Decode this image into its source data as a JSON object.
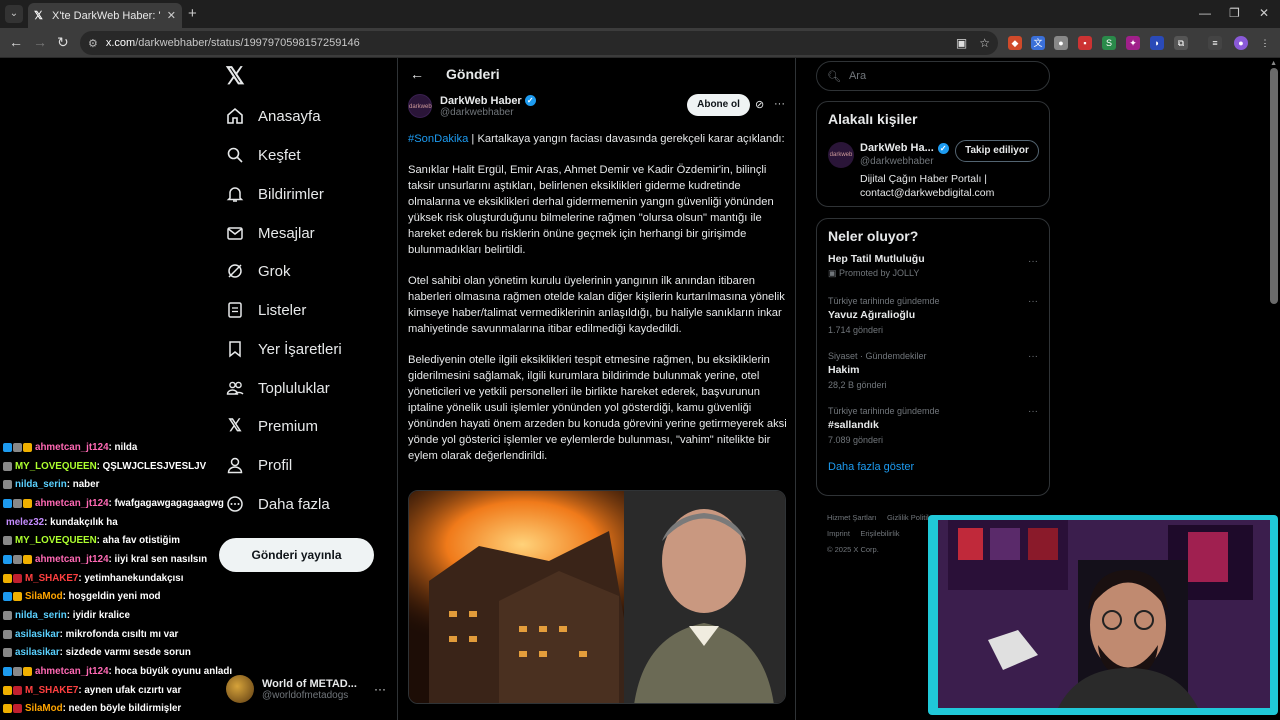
{
  "browser": {
    "tab_title": "X'te DarkWeb Haber: \"#SonDa",
    "url_host": "x.com",
    "url_path": "/darkwebhaber/status/1997970598157259146"
  },
  "nav": {
    "items": [
      {
        "label": "Anasayfa",
        "icon": "home-icon"
      },
      {
        "label": "Keşfet",
        "icon": "search-icon"
      },
      {
        "label": "Bildirimler",
        "icon": "bell-icon"
      },
      {
        "label": "Mesajlar",
        "icon": "mail-icon"
      },
      {
        "label": "Grok",
        "icon": "grok-icon"
      },
      {
        "label": "Listeler",
        "icon": "list-icon"
      },
      {
        "label": "Yer İşaretleri",
        "icon": "bookmark-icon"
      },
      {
        "label": "Topluluklar",
        "icon": "communities-icon"
      },
      {
        "label": "Premium",
        "icon": "x-logo-icon"
      },
      {
        "label": "Profil",
        "icon": "person-icon"
      },
      {
        "label": "Daha fazla",
        "icon": "more-circle-icon"
      }
    ],
    "post_button": "Gönderi yayınla",
    "account_name": "World of METAD...",
    "account_handle": "@worldofmetadogs"
  },
  "main": {
    "header_title": "Gönderi",
    "author_name": "DarkWeb Haber",
    "author_handle": "@darkwebhaber",
    "subscribe_label": "Abone ol",
    "tweet": {
      "hashtag": "#SonDakika",
      "p1_rest": " | Kartalkaya yangın faciası davasında gerekçeli karar açıklandı:",
      "p2": "Sanıklar Halit Ergül, Emir Aras, Ahmet Demir ve Kadir Özdemir'in, bilinçli taksir unsurlarını aştıkları, belirlenen eksiklikleri giderme kudretinde olmalarına ve eksiklikleri derhal gidermemenin yangın güvenliği yönünden yüksek risk oluşturduğunu bilmelerine rağmen \"olursa olsun\" mantığı ile hareket ederek bu risklerin önüne geçmek için herhangi bir girişimde bulunmadıkları belirtildi.",
      "p3": "Otel sahibi olan yönetim kurulu üyelerinin yangının ilk anından itibaren haberleri olmasına rağmen otelde kalan diğer kişilerin kurtarılmasına yönelik kimseye haber/talimat vermediklerinin anlaşıldığı, bu haliyle sanıkların inkar mahiyetinde savunmalarına itibar edilmediği kaydedildi.",
      "p4": "Belediyenin otelle ilgili eksiklikleri tespit etmesine rağmen, bu eksikliklerin giderilmesini sağlamak, ilgili kurumlara bildirimde bulunmak yerine, otel yöneticileri ve yetkili personelleri ile birlikte hareket ederek, başvurunun iptaline yönelik usuli işlemler yönünden yol gösterdiği, kamu güvenliği yönünden hayati önem arzeden bu konuda görevini yerine getirmeyerek aksi yönde yol gösterici işlemler ve eylemlerde bulunması, \"vahim\" nitelikte bir eylem olarak değerlendirildi."
    }
  },
  "right": {
    "search_placeholder": "Ara",
    "related_title": "Alakalı kişiler",
    "related_name": "DarkWeb Ha...",
    "related_handle": "@darkwebhaber",
    "related_follow": "Takip ediliyor",
    "related_bio": "Dijital Çağın Haber Portalı | contact@darkwebdigital.com",
    "trends_title": "Neler oluyor?",
    "trends": [
      {
        "context": "Promoted by JOLLY",
        "name": "Hep Tatil Mutluluğu",
        "count": ""
      },
      {
        "context": "Türkiye tarihinde gündemde",
        "name": "Yavuz Ağıralioğlu",
        "count": "1.714 gönderi"
      },
      {
        "context": "Siyaset · Gündemdekiler",
        "name": "Hakim",
        "count": "28,2 B gönderi"
      },
      {
        "context": "Türkiye tarihinde gündemde",
        "name": "#sallandık",
        "count": "7.089 gönderi"
      }
    ],
    "more_link": "Daha fazla göster",
    "footer": [
      "Hizmet Şartları",
      "Gizlilik Politikası",
      "Imprint",
      "Erişilebilirlik",
      "© 2025 X Corp."
    ]
  },
  "chat": [
    {
      "user": "ahmetcan_jt124",
      "color": "#ff69b4",
      "msg": ": nilda"
    },
    {
      "user": "MY_LOVEQUEEN",
      "color": "#adff2f",
      "msg": ": QŞLWJCLESJVESLJV"
    },
    {
      "user": "nilda_serin",
      "color": "#5ad1ff",
      "msg": ": naber"
    },
    {
      "user": "ahmetcan_jt124",
      "color": "#ff69b4",
      "msg": ": fwafgagawgagagaagwg"
    },
    {
      "user": "melez32",
      "color": "#c58cff",
      "msg": ": kundakçılık ha"
    },
    {
      "user": "MY_LOVEQUEEN",
      "color": "#adff2f",
      "msg": ": aha fav otistiğim"
    },
    {
      "user": "ahmetcan_jt124",
      "color": "#ff69b4",
      "msg": ": iiyi kral sen nasılsın"
    },
    {
      "user": "M_SHAKE7",
      "color": "#ff4040",
      "msg": ": yetimhanekundakçısı"
    },
    {
      "user": "SilaMod",
      "color": "#ffa500",
      "msg": ": hoşgeldin yeni mod"
    },
    {
      "user": "nilda_serin",
      "color": "#5ad1ff",
      "msg": ": iyidir kralice"
    },
    {
      "user": "asilasikar",
      "color": "#5ad1ff",
      "msg": ": mikrofonda cısıltı mı var"
    },
    {
      "user": "asilasikar",
      "color": "#5ad1ff",
      "msg": ": sizdede varmı sesde sorun"
    },
    {
      "user": "ahmetcan_jt124",
      "color": "#ff69b4",
      "msg": ": hoca büyük oyunu anladı"
    },
    {
      "user": "M_SHAKE7",
      "color": "#ff4040",
      "msg": ": aynen ufak cızırtı var"
    },
    {
      "user": "SilaMod",
      "color": "#ffa500",
      "msg": ": neden böyle bildirmişler"
    }
  ]
}
